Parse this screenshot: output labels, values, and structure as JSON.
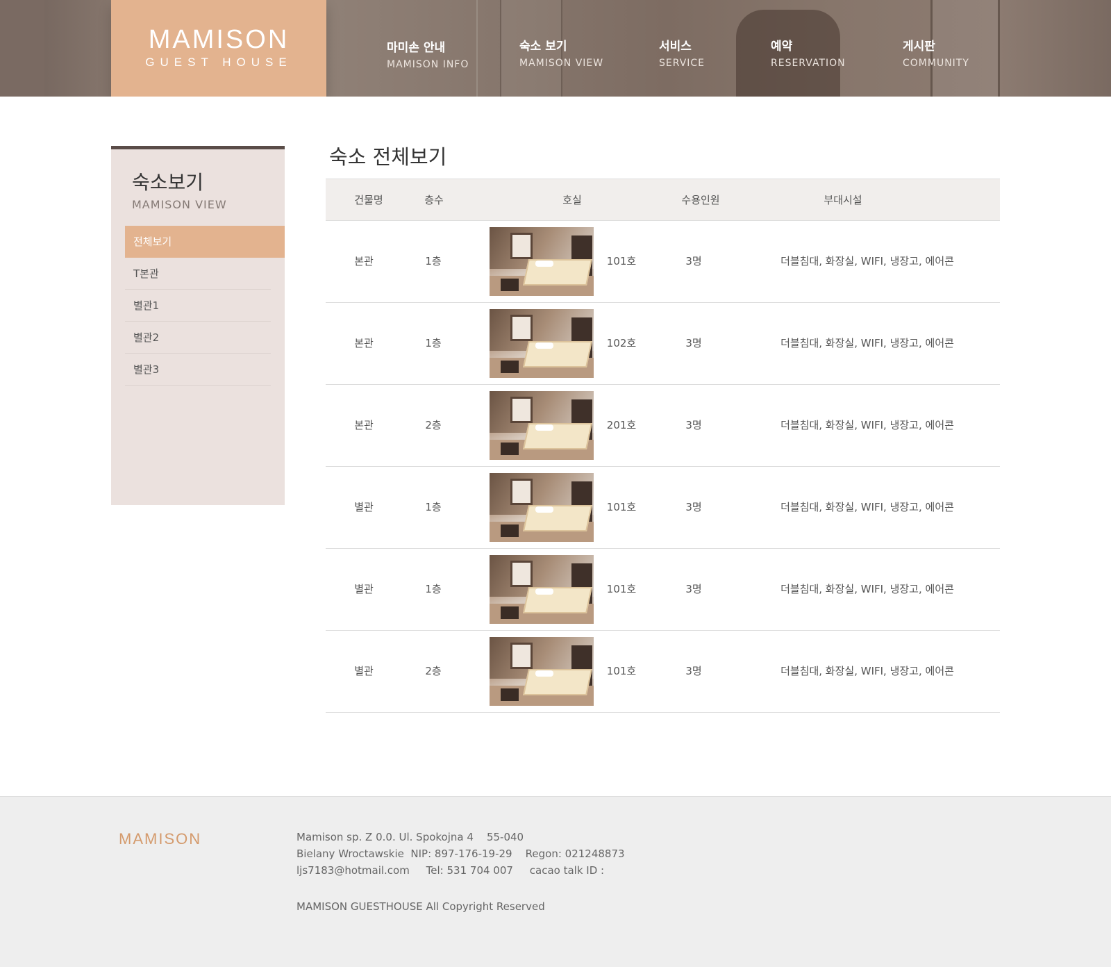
{
  "header": {
    "logo_main": "MAMISON",
    "logo_sub": "GUEST HOUSE",
    "nav": [
      {
        "kr": "마미손 안내",
        "en": "MAMISON INFO"
      },
      {
        "kr": "숙소 보기",
        "en": "MAMISON VIEW"
      },
      {
        "kr": "서비스",
        "en": "SERVICE"
      },
      {
        "kr": "예약",
        "en": "RESERVATION"
      },
      {
        "kr": "게시판",
        "en": "COMMUNITY"
      }
    ]
  },
  "sidebar": {
    "title": "숙소보기",
    "subtitle": "MAMISON VIEW",
    "items": [
      {
        "label": "전체보기",
        "active": true
      },
      {
        "label": "T본관",
        "active": false
      },
      {
        "label": "별관1",
        "active": false
      },
      {
        "label": "별관2",
        "active": false
      },
      {
        "label": "별관3",
        "active": false
      }
    ]
  },
  "main": {
    "title": "숙소 전체보기",
    "columns": {
      "building": "건물명",
      "floor": "층수",
      "room": "호실",
      "capacity": "수용인원",
      "amenities": "부대시설"
    },
    "rows": [
      {
        "building": "본관",
        "floor": "1층",
        "room": "101호",
        "capacity": "3명",
        "amenities": "더블침대, 화장실, WIFI, 냉장고, 에어콘"
      },
      {
        "building": "본관",
        "floor": "1층",
        "room": "102호",
        "capacity": "3명",
        "amenities": "더블침대, 화장실, WIFI, 냉장고, 에어콘"
      },
      {
        "building": "본관",
        "floor": "2층",
        "room": "201호",
        "capacity": "3명",
        "amenities": "더블침대, 화장실, WIFI, 냉장고, 에어콘"
      },
      {
        "building": "별관",
        "floor": "1층",
        "room": "101호",
        "capacity": "3명",
        "amenities": "더블침대, 화장실, WIFI, 냉장고, 에어콘"
      },
      {
        "building": "별관",
        "floor": "1층",
        "room": "101호",
        "capacity": "3명",
        "amenities": "더블침대, 화장실, WIFI, 냉장고, 에어콘"
      },
      {
        "building": "별관",
        "floor": "2층",
        "room": "101호",
        "capacity": "3명",
        "amenities": "더블침대, 화장실, WIFI, 냉장고, 에어콘"
      }
    ]
  },
  "footer": {
    "logo": "MAMISON",
    "address_line1": "Mamison sp. Z 0.0. Ul. Spokojna 4    55-040",
    "address_line2": "Bielany Wroctawskie  NIP: 897-176-19-29    Regon: 021248873",
    "contact_line": "ljs7183@hotmail.com     Tel: 531 704 007     cacao talk ID :",
    "copyright": "MAMISON GUESTHOUSE All Copyright Reserved"
  },
  "colors": {
    "accent": "#e3b38f",
    "header_bg": "#86766c",
    "sidebar_bg": "#ebe1de",
    "footer_logo": "#d49a6c"
  }
}
